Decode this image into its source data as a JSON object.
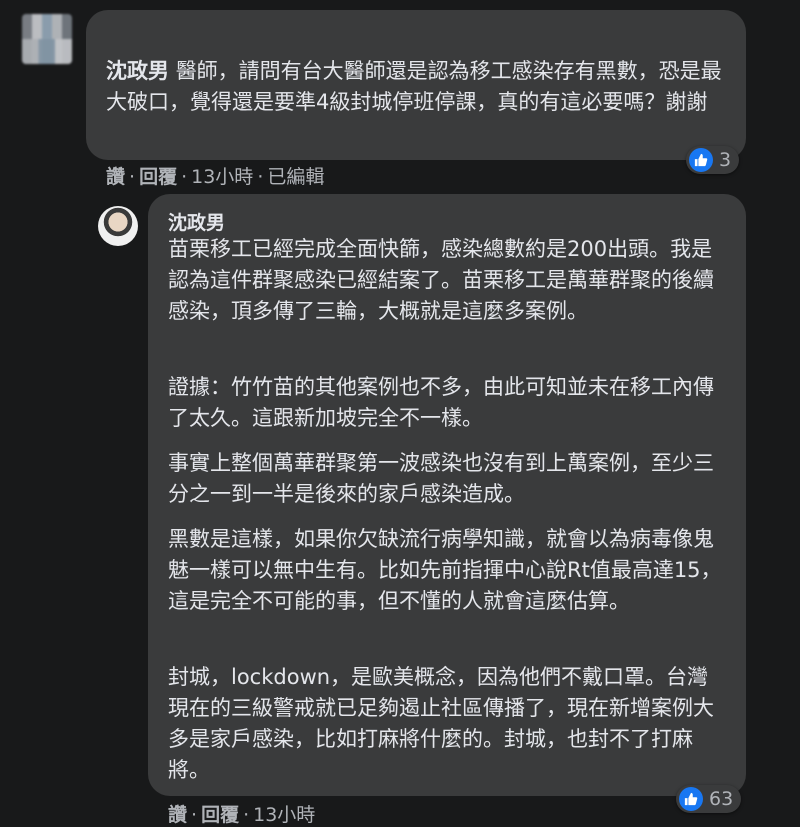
{
  "comment": {
    "author": "沈政男",
    "text": "醫師，請問有台大醫師還是認為移工感染存有黑數，恐是最大破口，覺得還是要準4級封城停班停課，真的有這必要嗎？謝謝",
    "actions": {
      "like": "讚",
      "reply": "回覆",
      "time": "13小時",
      "edited": "已編輯"
    },
    "reaction_count": "3"
  },
  "reply": {
    "author": "沈政男",
    "paragraphs": [
      "苗栗移工已經完成全面快篩，感染總數約是200出頭。我是認為這件群聚感染已經結案了。苗栗移工是萬華群聚的後續感染，頂多傳了三輪，大概就是這麼多案例。",
      "證據：竹竹苗的其他案例也不多，由此可知並未在移工內傳了太久。這跟新加坡完全不一樣。",
      "事實上整個萬華群聚第一波感染也沒有到上萬案例，至少三分之一到一半是後來的家戶感染造成。",
      "黑數是這樣，如果你欠缺流行病學知識，就會以為病毒像鬼魅一樣可以無中生有。比如先前指揮中心說Rt值最高達15，這是完全不可能的事，但不懂的人就會這麼估算。",
      "封城，lockdown，是歐美概念，因為他們不戴口罩。台灣現在的三級警戒就已足夠遏止社區傳播了，現在新增案例大多是家戶感染，比如打麻將什麼的。封城，也封不了打麻將。"
    ],
    "actions": {
      "like": "讚",
      "reply": "回覆",
      "time": "13小時"
    },
    "reaction_count": "63"
  },
  "colors": {
    "background": "#18191a",
    "bubble": "#3a3b3c",
    "text": "#e4e6eb",
    "muted": "#b0b3b8",
    "like": "#1877f2"
  },
  "icons": {
    "reaction": "like-thumb-icon"
  }
}
